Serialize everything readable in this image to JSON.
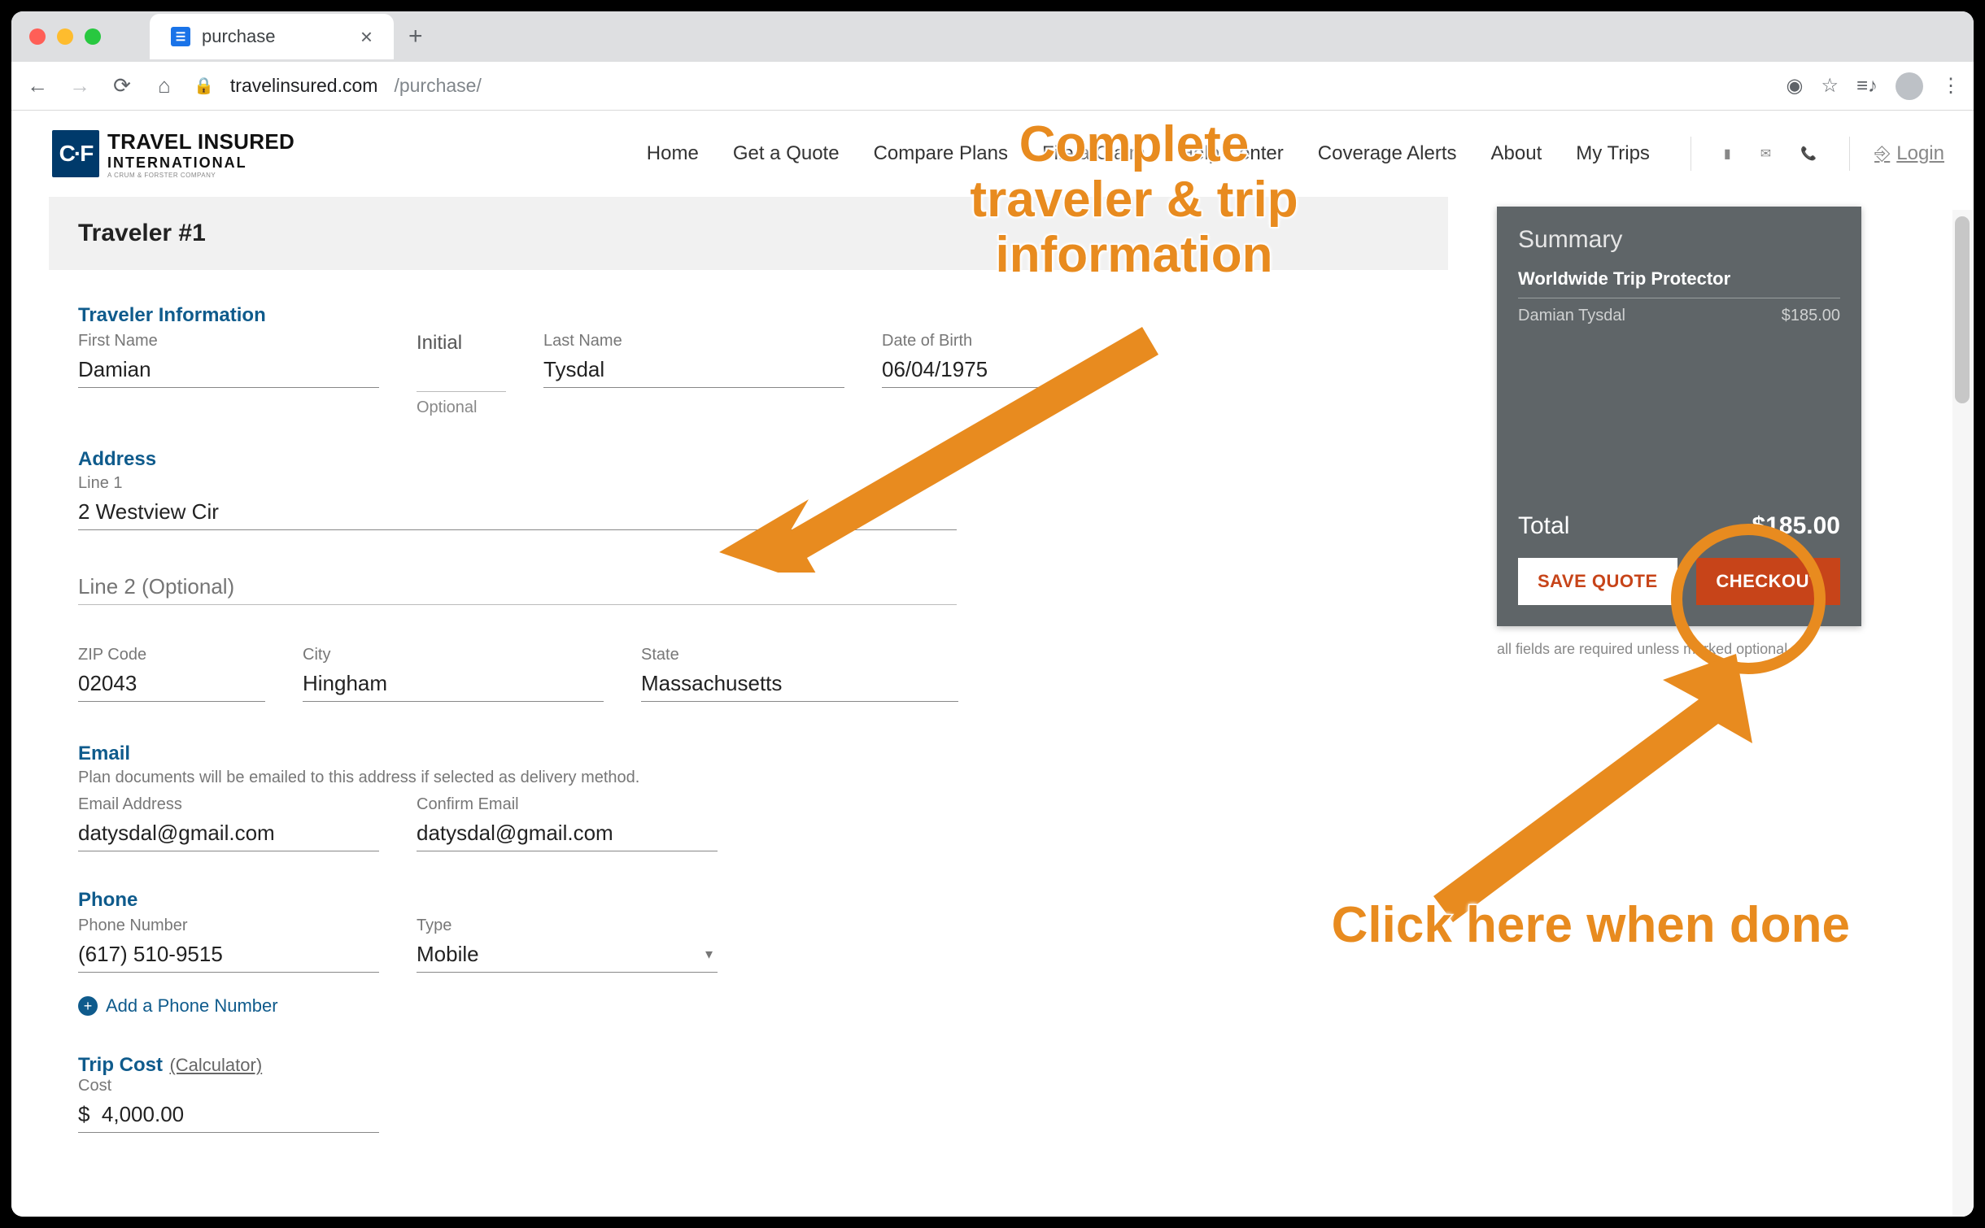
{
  "browser": {
    "tab_title": "purchase",
    "url_host": "travelinsured.com",
    "url_path": "/purchase/"
  },
  "header": {
    "logo_badge": "C·F",
    "logo_line1": "TRAVEL INSURED",
    "logo_line2": "INTERNATIONAL",
    "logo_line3": "A CRUM & FORSTER COMPANY",
    "nav": [
      "Home",
      "Get a Quote",
      "Compare Plans",
      "File a Claim",
      "Help Center",
      "Coverage Alerts",
      "About",
      "My Trips"
    ],
    "login": "Login"
  },
  "traveler": {
    "card_title": "Traveler #1",
    "info_heading": "Traveler Information",
    "first_name_label": "First Name",
    "first_name": "Damian",
    "initial_label": "Initial",
    "initial_hint": "Optional",
    "last_name_label": "Last Name",
    "last_name": "Tysdal",
    "dob_label": "Date of Birth",
    "dob": "06/04/1975",
    "address_heading": "Address",
    "line1_label": "Line 1",
    "line1": "2 Westview Cir",
    "line2_placeholder": "Line 2 (Optional)",
    "zip_label": "ZIP Code",
    "zip": "02043",
    "city_label": "City",
    "city": "Hingham",
    "state_label": "State",
    "state": "Massachusetts",
    "email_heading": "Email",
    "email_sub": "Plan documents will be emailed to this address if selected as delivery method.",
    "email_label": "Email Address",
    "email": "datysdal@gmail.com",
    "confirm_label": "Confirm Email",
    "confirm_email": "datysdal@gmail.com",
    "phone_heading": "Phone",
    "phone_label": "Phone Number",
    "phone": "(617) 510-9515",
    "type_label": "Type",
    "phone_type": "Mobile",
    "add_phone": "Add a Phone Number",
    "tripcost_heading": "Trip Cost",
    "calculator": "(Calculator)",
    "cost_label": "Cost",
    "cost": "$  4,000.00"
  },
  "summary": {
    "title": "Summary",
    "plan": "Worldwide Trip Protector",
    "traveler_name": "Damian Tysdal",
    "traveler_price": "$185.00",
    "total_label": "Total",
    "total": "$185.00",
    "save_quote": "SAVE QUOTE",
    "checkout": "CHECKOUT",
    "required_note": "all fields are required unless marked optional"
  },
  "annotations": {
    "top_line1": "Complete",
    "top_line2": "traveler & trip",
    "top_line3": "information",
    "bottom": "Click here when done"
  }
}
